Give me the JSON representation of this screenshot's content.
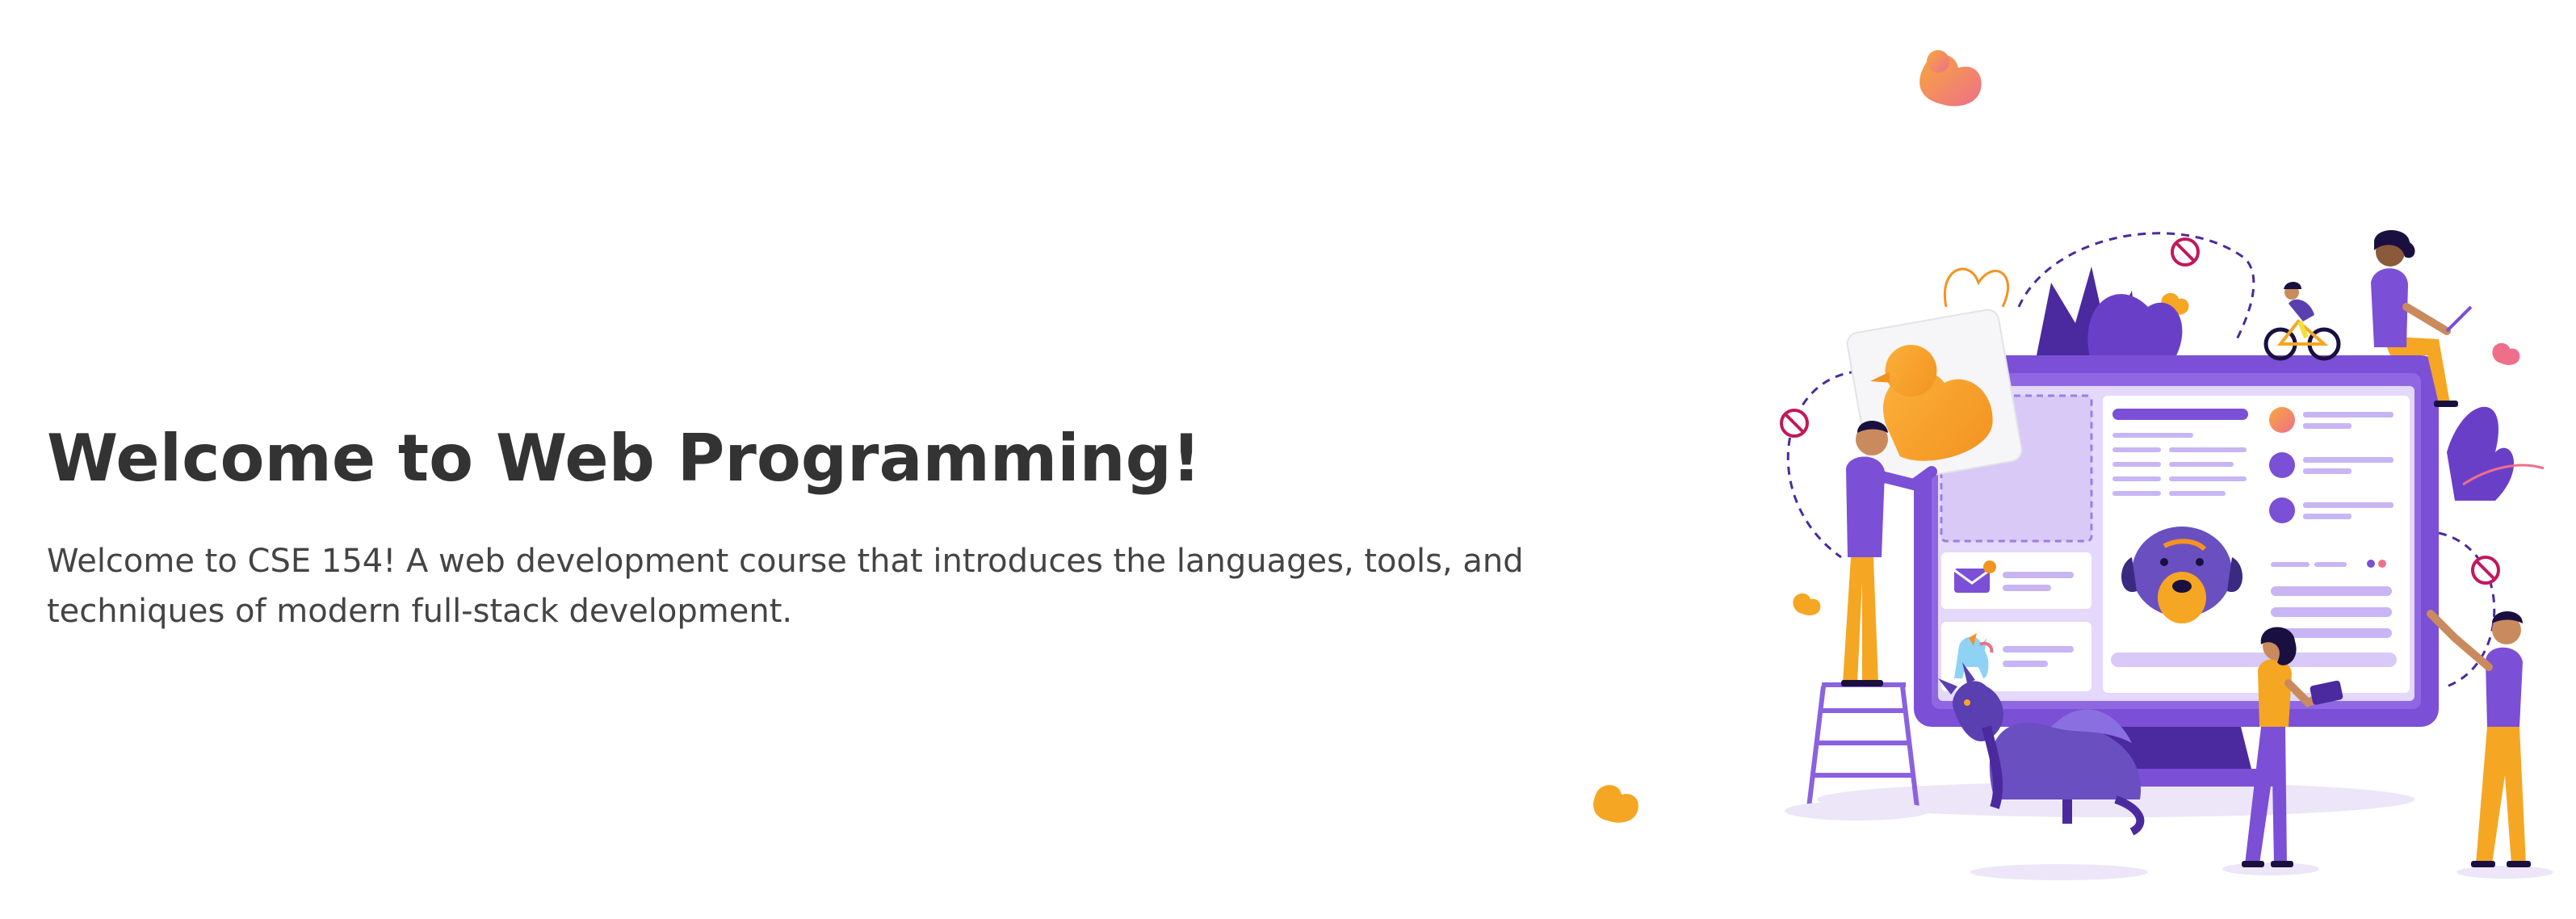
{
  "hero": {
    "title": "Welcome to Web Programming!",
    "description": "Welcome to CSE 154! A web development course that introduces the languages, tools, and techniques of modern full-stack development."
  },
  "illustration": {
    "name": "web-development-team-illustration",
    "icons": [
      "duck-icon",
      "dragon-icon",
      "dog-face-icon",
      "unicorn-icon",
      "envelope-icon",
      "cyclist-icon",
      "no-bugs-icon"
    ]
  },
  "colors": {
    "title": "#333333",
    "text": "#444444",
    "purple": "#7b4fd6",
    "purple_light": "#e4d8fb",
    "purple_dark": "#4a2a9e",
    "orange": "#f5a623",
    "pink": "#ef6f8a"
  }
}
